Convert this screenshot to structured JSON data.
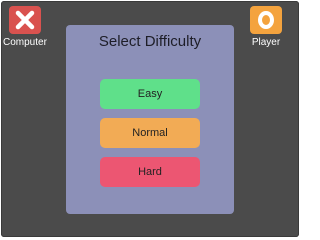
{
  "players": {
    "computer": {
      "label": "Computer",
      "mark_icon": "x-mark-icon",
      "color": "#d9524f"
    },
    "player": {
      "label": "Player",
      "mark_icon": "o-mark-icon",
      "color": "#f4a33e"
    }
  },
  "dialog": {
    "title": "Select Difficulty",
    "buttons": {
      "easy": {
        "label": "Easy",
        "color": "#5fe08a"
      },
      "normal": {
        "label": "Normal",
        "color": "#f2ab55"
      },
      "hard": {
        "label": "Hard",
        "color": "#ec5672"
      }
    },
    "panel_color": "#8c90b8"
  },
  "background_color": "#4b4b4b"
}
